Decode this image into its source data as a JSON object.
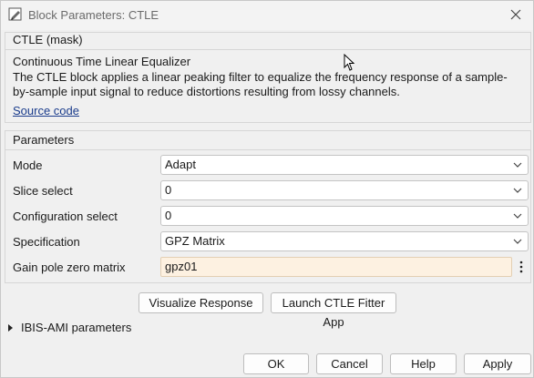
{
  "window": {
    "title": "Block Parameters: CTLE"
  },
  "mask": {
    "header": "CTLE (mask)",
    "desc_title": "Continuous Time Linear Equalizer",
    "desc": "The CTLE block applies a linear peaking filter to equalize the frequency response of a sample-by-sample input signal to reduce distortions resulting from lossy channels.",
    "source_link": "Source code"
  },
  "parameters": {
    "header": "Parameters",
    "rows": [
      {
        "label": "Mode",
        "value": "Adapt"
      },
      {
        "label": "Slice select",
        "value": "0"
      },
      {
        "label": "Configuration select",
        "value": "0"
      },
      {
        "label": "Specification",
        "value": "GPZ Matrix"
      },
      {
        "label": "Gain pole zero matrix",
        "value": "gpz01"
      }
    ]
  },
  "actions": {
    "visualize": "Visualize Response",
    "launch_fitter": "Launch CTLE Fitter App"
  },
  "ibis": {
    "label": "IBIS-AMI parameters"
  },
  "footer": {
    "ok": "OK",
    "cancel": "Cancel",
    "help": "Help",
    "apply": "Apply"
  },
  "icons": {
    "title": "block-parameters-icon",
    "close": "close-icon",
    "dropdown": "chevron-down-icon",
    "kebab": "more-options-icon",
    "expander": "triangle-right-icon"
  }
}
